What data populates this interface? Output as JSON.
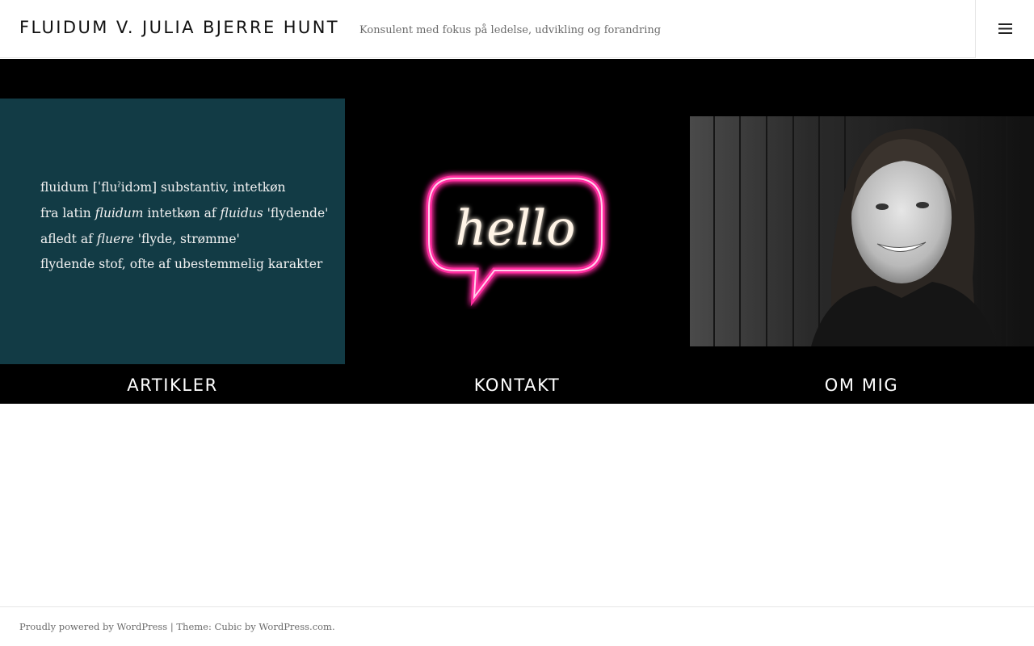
{
  "header": {
    "site_title": "FLUIDUM V. JULIA BJERRE HUNT",
    "site_description": "Konsulent med fokus på ledelse, udvikling og forandring",
    "menu_toggle_icon": "hamburger-icon"
  },
  "tiles": [
    {
      "label": "ARTIKLER",
      "definition": {
        "line1": "fluidum [ˈfluˀidɔm] substantiv, intetkøn",
        "line2_pre": "fra latin ",
        "line2_em1": "fluidum",
        "line2_mid": " intetkøn af ",
        "line2_em2": "fluidus",
        "line2_post": " 'flydende'",
        "line3_pre": "afledt af ",
        "line3_em": "fluere",
        "line3_post": " 'flyde, strømme'",
        "line4": "flydende stof, ofte af ubestemmelig karakter"
      },
      "card_color": "#123b45"
    },
    {
      "label": "KONTAKT",
      "sign_text": "hello",
      "neon_color": "#ff2fa0"
    },
    {
      "label": "OM MIG"
    }
  ],
  "footer": {
    "powered_by": "Proudly powered by WordPress",
    "separator": " | ",
    "theme_prefix": "Theme: Cubic by ",
    "theme_link": "WordPress.com",
    "trailing": "."
  }
}
